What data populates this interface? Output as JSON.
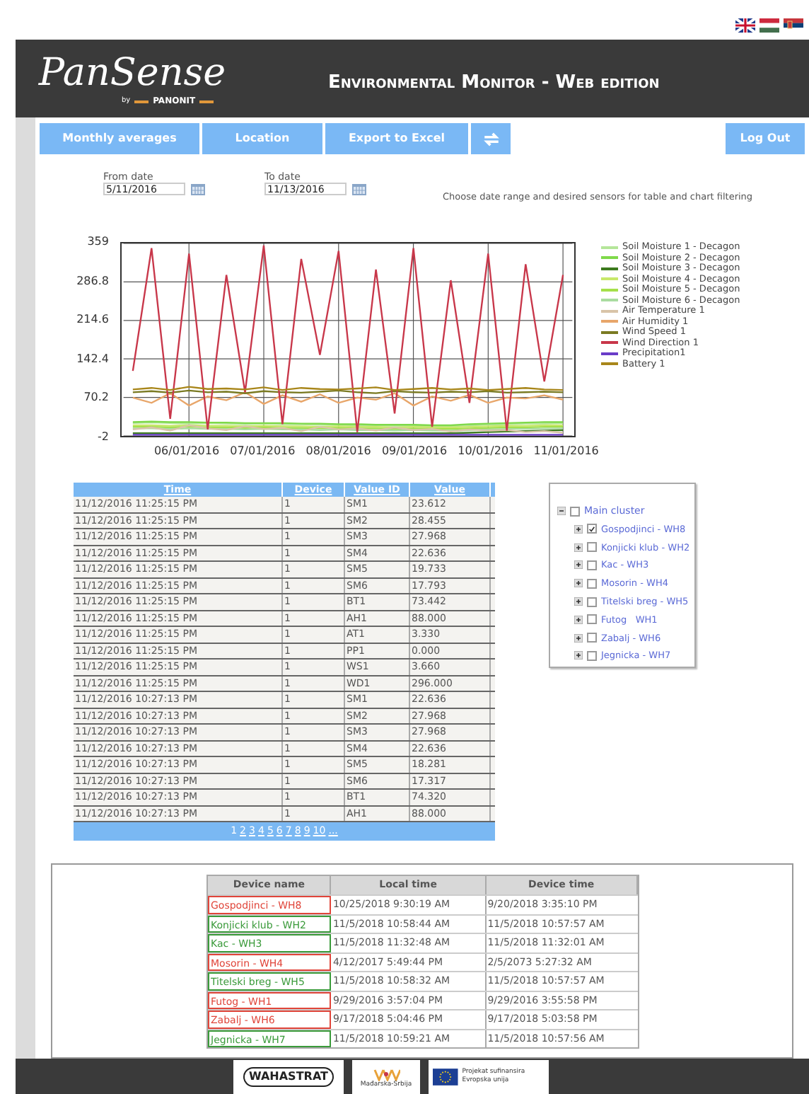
{
  "header": {
    "logo": "PanSense",
    "logo_by": "by",
    "logo_brand": "PANONIT",
    "title": "Environmental Monitor - Web edition"
  },
  "nav": [
    {
      "label": "Monthly averages",
      "kind": "text"
    },
    {
      "label": "Location",
      "kind": "text"
    },
    {
      "label": "Export to Excel",
      "kind": "text"
    },
    {
      "kind": "refresh"
    },
    {
      "label": "Log Out",
      "kind": "text"
    }
  ],
  "filters": {
    "from_label": "From date",
    "from_value": "5/11/2016",
    "to_label": "To date",
    "to_value": "11/13/2016",
    "hint": "Choose date range and desired sensors for table and chart filtering"
  },
  "chart": {
    "chart_data": {
      "type": "line",
      "grid": true,
      "legend": "right",
      "categories": [
        null,
        null,
        null,
        "06/01/2016",
        null,
        null,
        null,
        "07/01/2016",
        null,
        null,
        null,
        "08/01/2016",
        null,
        null,
        null,
        "09/01/2016",
        null,
        null,
        null,
        "10/01/2016",
        null,
        null,
        null,
        "11/01/2016"
      ],
      "ylim": [
        -2,
        359
      ],
      "yticks": [
        {
          "value": 359,
          "label": "359"
        },
        {
          "value": 286.8,
          "label": "286.8"
        },
        {
          "value": 214.6,
          "label": "214.6"
        },
        {
          "value": 142.4,
          "label": "142.4"
        },
        {
          "value": 70.2,
          "label": "70.2"
        },
        {
          "value": -2,
          "label": "-2"
        }
      ],
      "series": [
        {
          "name": "Soil Moisture 1 - Decagon",
          "color": "#b5e69a",
          "values": [
            22,
            23,
            22,
            21,
            22,
            21,
            20,
            21,
            20,
            20,
            19,
            19,
            18,
            18,
            17,
            17,
            16,
            16,
            18,
            19,
            20,
            21,
            21,
            22
          ]
        },
        {
          "name": "Soil Moisture 2 - Decagon",
          "color": "#7fd94a",
          "values": [
            24,
            25,
            24,
            24,
            23,
            23,
            22,
            22,
            22,
            21,
            21,
            20,
            20,
            19,
            19,
            19,
            18,
            18,
            20,
            21,
            22,
            23,
            24,
            24
          ]
        },
        {
          "name": "Soil Moisture 3 - Decagon",
          "color": "#3c7a1e",
          "values": [
            3,
            3,
            3,
            3,
            3,
            3,
            3,
            3,
            3,
            3,
            3,
            3,
            3,
            3,
            3,
            3,
            3,
            3,
            4,
            5,
            6,
            7,
            8,
            9
          ]
        },
        {
          "name": "Soil Moisture 4 - Decagon",
          "color": "#c8e86a",
          "values": [
            18,
            18,
            17,
            18,
            17,
            17,
            16,
            17,
            16,
            16,
            15,
            16,
            15,
            15,
            14,
            15,
            14,
            14,
            15,
            16,
            17,
            17,
            18,
            18
          ]
        },
        {
          "name": "Soil Moisture 5 - Decagon",
          "color": "#a5e04a",
          "values": [
            15,
            15,
            14,
            15,
            14,
            14,
            13,
            14,
            13,
            13,
            12,
            13,
            12,
            12,
            11,
            12,
            11,
            11,
            12,
            13,
            14,
            14,
            15,
            15
          ]
        },
        {
          "name": "Soil Moisture 6 - Decagon",
          "color": "#a9dca0",
          "values": [
            12,
            12,
            11,
            12,
            11,
            11,
            10,
            11,
            10,
            10,
            9,
            10,
            9,
            9,
            8,
            9,
            8,
            8,
            9,
            10,
            11,
            11,
            12,
            12
          ]
        },
        {
          "name": "Air Temperature 1",
          "color": "#d9c4a8",
          "values": [
            10,
            14,
            8,
            18,
            12,
            9,
            16,
            11,
            13,
            7,
            15,
            10,
            12,
            8,
            14,
            9,
            11,
            6,
            10,
            8,
            9,
            5,
            7,
            4
          ]
        },
        {
          "name": "Air Humidity 1",
          "color": "#e8a66a",
          "values": [
            70,
            60,
            78,
            55,
            72,
            65,
            80,
            58,
            74,
            62,
            76,
            60,
            70,
            66,
            78,
            55,
            72,
            64,
            75,
            60,
            70,
            68,
            74,
            66
          ]
        },
        {
          "name": "Wind Speed 1",
          "color": "#7a7a22",
          "values": [
            80,
            82,
            79,
            83,
            80,
            81,
            78,
            82,
            80,
            79,
            81,
            83,
            80,
            78,
            82,
            80,
            79,
            81,
            80,
            82,
            79,
            80,
            81,
            80
          ]
        },
        {
          "name": "Wind Direction 1",
          "color": "#c8374a",
          "values": [
            120,
            350,
            30,
            340,
            10,
            300,
            80,
            355,
            20,
            330,
            150,
            345,
            5,
            310,
            40,
            350,
            15,
            290,
            60,
            340,
            8,
            320,
            100,
            300
          ]
        },
        {
          "name": "Precipitation1",
          "color": "#6a3cc8",
          "values": [
            0,
            0,
            0,
            0,
            0,
            0,
            0,
            0,
            0,
            0,
            0,
            0,
            0,
            0,
            0,
            0,
            0,
            0,
            0,
            0,
            0,
            0,
            0,
            0
          ]
        },
        {
          "name": "Battery 1",
          "color": "#a8861a",
          "values": [
            85,
            88,
            84,
            90,
            86,
            87,
            85,
            89,
            84,
            88,
            86,
            85,
            87,
            89,
            84,
            86,
            88,
            85,
            87,
            84,
            86,
            88,
            85,
            84
          ]
        }
      ]
    }
  },
  "table": {
    "columns": [
      "Time",
      "Device",
      "Value ID",
      "Value"
    ],
    "rows": [
      [
        "11/12/2016 11:25:15 PM",
        "1",
        "SM1",
        "23.612"
      ],
      [
        "11/12/2016 11:25:15 PM",
        "1",
        "SM2",
        "28.455"
      ],
      [
        "11/12/2016 11:25:15 PM",
        "1",
        "SM3",
        "27.968"
      ],
      [
        "11/12/2016 11:25:15 PM",
        "1",
        "SM4",
        "22.636"
      ],
      [
        "11/12/2016 11:25:15 PM",
        "1",
        "SM5",
        "19.733"
      ],
      [
        "11/12/2016 11:25:15 PM",
        "1",
        "SM6",
        "17.793"
      ],
      [
        "11/12/2016 11:25:15 PM",
        "1",
        "BT1",
        "73.442"
      ],
      [
        "11/12/2016 11:25:15 PM",
        "1",
        "AH1",
        "88.000"
      ],
      [
        "11/12/2016 11:25:15 PM",
        "1",
        "AT1",
        "3.330"
      ],
      [
        "11/12/2016 11:25:15 PM",
        "1",
        "PP1",
        "0.000"
      ],
      [
        "11/12/2016 11:25:15 PM",
        "1",
        "WS1",
        "3.660"
      ],
      [
        "11/12/2016 11:25:15 PM",
        "1",
        "WD1",
        "296.000"
      ],
      [
        "11/12/2016 10:27:13 PM",
        "1",
        "SM1",
        "22.636"
      ],
      [
        "11/12/2016 10:27:13 PM",
        "1",
        "SM2",
        "27.968"
      ],
      [
        "11/12/2016 10:27:13 PM",
        "1",
        "SM3",
        "27.968"
      ],
      [
        "11/12/2016 10:27:13 PM",
        "1",
        "SM4",
        "22.636"
      ],
      [
        "11/12/2016 10:27:13 PM",
        "1",
        "SM5",
        "18.281"
      ],
      [
        "11/12/2016 10:27:13 PM",
        "1",
        "SM6",
        "17.317"
      ],
      [
        "11/12/2016 10:27:13 PM",
        "1",
        "BT1",
        "74.320"
      ],
      [
        "11/12/2016 10:27:13 PM",
        "1",
        "AH1",
        "88.000"
      ]
    ],
    "pages": [
      {
        "label": "1",
        "selected": true
      },
      {
        "label": "2",
        "selected": false
      },
      {
        "label": "3",
        "selected": false
      },
      {
        "label": "4",
        "selected": false
      },
      {
        "label": "5",
        "selected": false
      },
      {
        "label": "6",
        "selected": false
      },
      {
        "label": "7",
        "selected": false
      },
      {
        "label": "8",
        "selected": false
      },
      {
        "label": "9",
        "selected": false
      },
      {
        "label": "10",
        "selected": false
      },
      {
        "label": "...",
        "selected": false
      }
    ]
  },
  "tree": {
    "label": "Main cluster",
    "expanded": true,
    "checked": false,
    "children": [
      {
        "label": "Gospodjinci - WH8",
        "expanded": false,
        "checked": true
      },
      {
        "label": "Konjicki klub - WH2",
        "expanded": false,
        "checked": false
      },
      {
        "label": "Kac - WH3",
        "expanded": false,
        "checked": false
      },
      {
        "label": "Mosorin - WH4",
        "expanded": false,
        "checked": false
      },
      {
        "label": "Titelski breg - WH5",
        "expanded": false,
        "checked": false
      },
      {
        "label": "Futog   WH1",
        "expanded": false,
        "checked": false
      },
      {
        "label": "Zabalj - WH6",
        "expanded": false,
        "checked": false
      },
      {
        "label": "Jegnicka - WH7",
        "expanded": false,
        "checked": false
      }
    ]
  },
  "status": {
    "columns": [
      "Device name",
      "Local time",
      "Device time"
    ],
    "rows": [
      {
        "name": "Gospodjinci - WH8",
        "color": "#e0453a",
        "local": "10/25/2018 9:30:19 AM",
        "device": "9/20/2018 3:35:10 PM"
      },
      {
        "name": "Konjicki klub - WH2",
        "color": "#3a9a3a",
        "local": "11/5/2018 10:58:44 AM",
        "device": "11/5/2018 10:57:57 AM"
      },
      {
        "name": "Kac - WH3",
        "color": "#3a9a3a",
        "local": "11/5/2018 11:32:48 AM",
        "device": "11/5/2018 11:32:01 AM"
      },
      {
        "name": "Mosorin - WH4",
        "color": "#e0453a",
        "local": "4/12/2017 5:49:44 PM",
        "device": "2/5/2073 5:27:32 AM"
      },
      {
        "name": "Titelski breg - WH5",
        "color": "#3a9a3a",
        "local": "11/5/2018 10:58:32 AM",
        "device": "11/5/2018 10:57:57 AM"
      },
      {
        "name": "Futog - WH1",
        "color": "#e0453a",
        "local": "9/29/2016 3:57:04 PM",
        "device": "9/29/2016 3:55:58 PM"
      },
      {
        "name": "Zabalj - WH6",
        "color": "#e0453a",
        "local": "9/17/2018 5:04:46 PM",
        "device": "9/17/2018 5:03:58 PM"
      },
      {
        "name": "Jegnicka - WH7",
        "color": "#3a9a3a",
        "local": "11/5/2018 10:59:21 AM",
        "device": "11/5/2018 10:57:56 AM"
      }
    ]
  },
  "footer": {
    "wahastrat": "WAHASTRAT",
    "region": "Mađarska-Srbija",
    "eu": "Projekat sufinansira Evropska unija"
  }
}
